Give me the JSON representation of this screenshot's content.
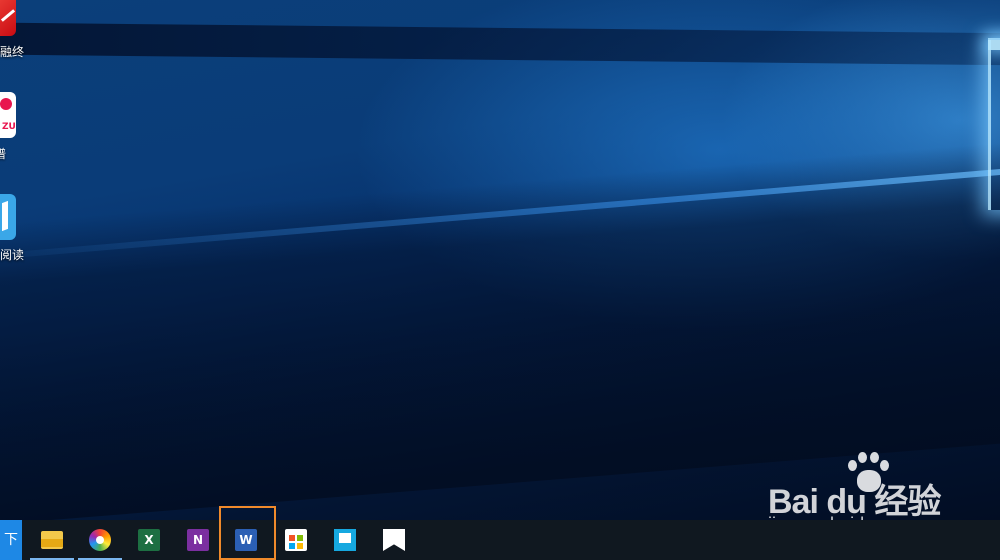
{
  "desktop": {
    "icons": [
      {
        "label": "金融终",
        "icon": "finance-terminal-icon"
      },
      {
        "label": "谱",
        "icon": "music-app-icon"
      },
      {
        "label": "开阅读",
        "icon": "reader-app-icon"
      }
    ]
  },
  "taskbar": {
    "start_label": "下",
    "apps": [
      {
        "name": "File Explorer",
        "icon": "folder-icon",
        "glyph": ""
      },
      {
        "name": "Color App",
        "icon": "color-wheel-icon",
        "glyph": ""
      },
      {
        "name": "Excel",
        "icon": "excel-icon",
        "glyph": "X"
      },
      {
        "name": "OneNote",
        "icon": "onenote-icon",
        "glyph": "N"
      },
      {
        "name": "Word",
        "icon": "word-icon",
        "glyph": "W"
      },
      {
        "name": "Microsoft Store",
        "icon": "store-icon",
        "glyph": ""
      },
      {
        "name": "News",
        "icon": "news-icon",
        "glyph": ""
      },
      {
        "name": "Bookmark App",
        "icon": "bookmark-icon",
        "glyph": ""
      }
    ],
    "highlight_color": "#f08a2b"
  },
  "watermark": {
    "main": "Bai  du 经验",
    "sub": "jingyan.baidu.com"
  }
}
